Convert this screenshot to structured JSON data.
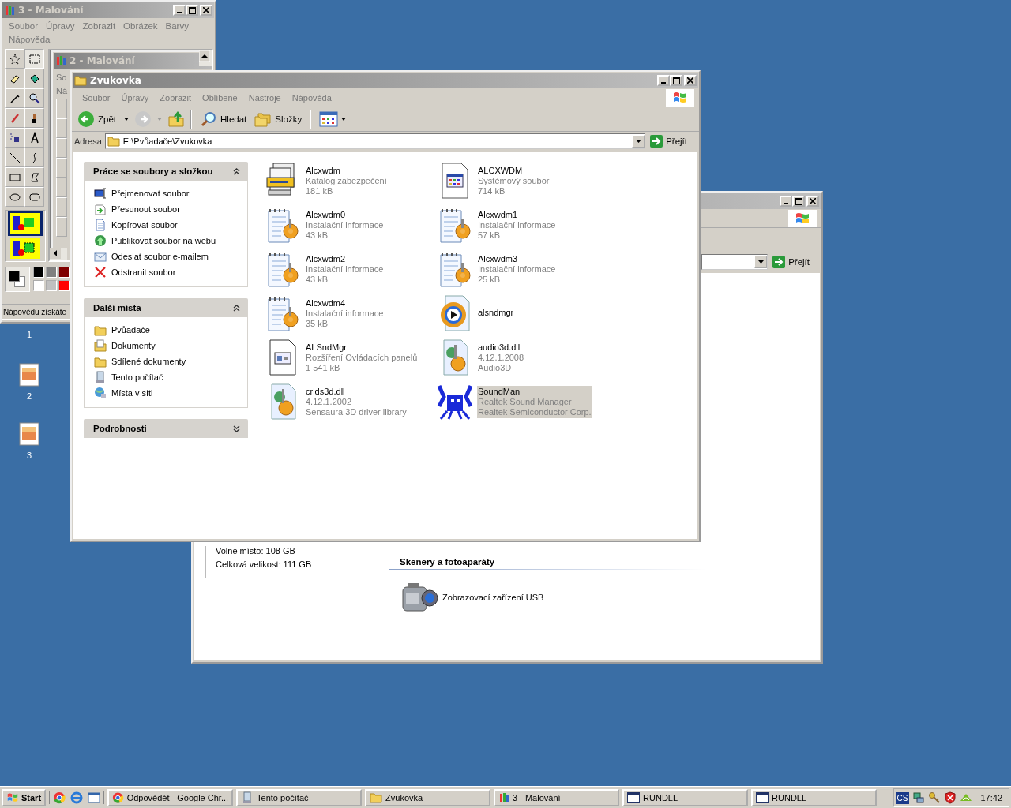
{
  "desktop_icons": [
    {
      "label": "1"
    },
    {
      "label": "2"
    },
    {
      "label": "3"
    }
  ],
  "paint_back": {
    "title": "3 - Malování",
    "menu": [
      "Soubor",
      "Úpravy",
      "Zobrazit",
      "Obrázek",
      "Barvy",
      "Nápověda"
    ],
    "status": "Nápovědu získáte"
  },
  "paint_front": {
    "title": "2 - Malování",
    "menu": [
      "So",
      "Ná"
    ]
  },
  "computer_window": {
    "go_button": "Přejít",
    "details": [
      "Volné místo: 108 GB",
      "Celková velikost: 111 GB"
    ],
    "section": "Skenery a fotoaparáty",
    "devices": [
      {
        "label": "Zobrazovací zařízení USB"
      }
    ]
  },
  "explorer": {
    "title": "Zvukovka",
    "menu": [
      "Soubor",
      "Úpravy",
      "Zobrazit",
      "Oblíbené",
      "Nástroje",
      "Nápověda"
    ],
    "back": "Zpět",
    "search": "Hledat",
    "folders": "Složky",
    "address_label": "Adresa",
    "address": "E:\\Pvůadače\\Zvukovka",
    "go_button": "Přejít",
    "task_panels": [
      {
        "title": "Práce se soubory a složkou",
        "expanded": true,
        "items": [
          {
            "label": "Přejmenovat soubor",
            "kind": "rename"
          },
          {
            "label": "Přesunout soubor",
            "kind": "move"
          },
          {
            "label": "Kopírovat soubor",
            "kind": "copy"
          },
          {
            "label": "Publikovat soubor na webu",
            "kind": "web"
          },
          {
            "label": "Odeslat soubor e-mailem",
            "kind": "mail"
          },
          {
            "label": "Odstranit soubor",
            "kind": "delete"
          }
        ]
      },
      {
        "title": "Další místa",
        "expanded": true,
        "items": [
          {
            "label": "Pvůadače",
            "kind": "folder"
          },
          {
            "label": "Dokumenty",
            "kind": "docs"
          },
          {
            "label": "Sdílené dokumenty",
            "kind": "folder"
          },
          {
            "label": "Tento počítač",
            "kind": "computer"
          },
          {
            "label": "Místa v síti",
            "kind": "network"
          }
        ]
      },
      {
        "title": "Podrobnosti",
        "expanded": false
      }
    ],
    "files": [
      {
        "name": "Alcxwdm",
        "lines": [
          "Katalog zabezpečení",
          "181 kB"
        ],
        "kind": "catalog",
        "selected": false
      },
      {
        "name": "ALCXWDM",
        "lines": [
          "Systémový soubor",
          "714 kB"
        ],
        "kind": "sysfile",
        "selected": false
      },
      {
        "name": "Alcxwdm0",
        "lines": [
          "Instalační informace",
          "43 kB"
        ],
        "kind": "inf",
        "selected": false
      },
      {
        "name": "Alcxwdm1",
        "lines": [
          "Instalační informace",
          "57 kB"
        ],
        "kind": "inf",
        "selected": false
      },
      {
        "name": "Alcxwdm2",
        "lines": [
          "Instalační informace",
          "43 kB"
        ],
        "kind": "inf",
        "selected": false
      },
      {
        "name": "Alcxwdm3",
        "lines": [
          "Instalační informace",
          "25 kB"
        ],
        "kind": "inf",
        "selected": false
      },
      {
        "name": "Alcxwdm4",
        "lines": [
          "Instalační informace",
          "35 kB"
        ],
        "kind": "inf",
        "selected": false
      },
      {
        "name": "alsndmgr",
        "kind": "media",
        "selected": false
      },
      {
        "name": "ALSndMgr",
        "lines": [
          "Rozšíření Ovládacích panelů",
          "1 541 kB"
        ],
        "kind": "cpl",
        "selected": false
      },
      {
        "name": "audio3d.dll",
        "lines": [
          "4.12.1.2008",
          "Audio3D"
        ],
        "kind": "dll",
        "selected": false
      },
      {
        "name": "crlds3d.dll",
        "lines": [
          "4.12.1.2002",
          "Sensaura 3D driver library"
        ],
        "kind": "dll",
        "selected": false
      },
      {
        "name": "SoundMan",
        "lines": [
          "Realtek Sound Manager",
          "Realtek Semiconductor Corp."
        ],
        "kind": "realtek",
        "selected": true
      }
    ]
  },
  "taskbar": {
    "start": "Start",
    "tasks": [
      {
        "label": "Odpovědět - Google Chr...",
        "kind": "chrome",
        "selected": false
      },
      {
        "label": "Tento počítač",
        "kind": "computer",
        "selected": false
      },
      {
        "label": "Zvukovka",
        "kind": "folder",
        "selected": false
      },
      {
        "label": "3 - Malování",
        "kind": "paint",
        "selected": false
      },
      {
        "label": "RUNDLL",
        "kind": "window",
        "selected": false
      },
      {
        "label": "RUNDLL",
        "kind": "window",
        "selected": false
      }
    ],
    "language": "CS",
    "clock": "17:42"
  }
}
